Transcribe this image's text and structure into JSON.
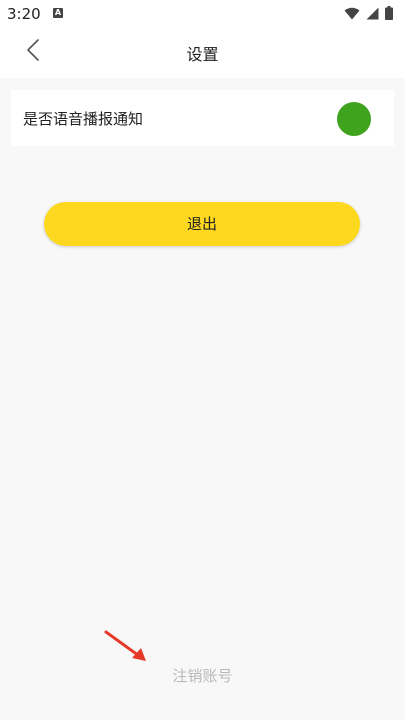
{
  "status_bar": {
    "time": "3:20",
    "notification_icon": "a-icon",
    "wifi_icon": "wifi-icon",
    "signal_icon": "signal-icon",
    "battery_icon": "battery-icon"
  },
  "app_bar": {
    "back_icon": "chevron-left-icon",
    "title": "设置"
  },
  "settings": {
    "voice_notification_label": "是否语音播报通知",
    "voice_notification_toggle_color": "#3fa31e"
  },
  "actions": {
    "logout_label": "退出",
    "logout_color": "#fdd81f",
    "delete_account_label": "注销账号"
  },
  "annotation": {
    "arrow_color": "#e53a2a"
  }
}
